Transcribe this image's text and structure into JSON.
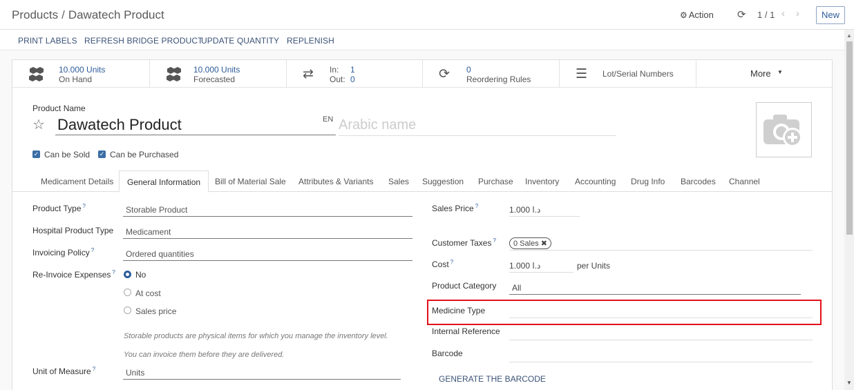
{
  "breadcrumb": {
    "parent": "Products",
    "separator": "/",
    "current": "Dawatech Product"
  },
  "topbar": {
    "action_label": "Action",
    "pager": "1 / 1",
    "new_label": "New"
  },
  "buttons": [
    "PRINT LABELS",
    "REFRESH BRIDGE PRODUCT",
    "UPDATE QUANTITY",
    "REPLENISH"
  ],
  "stats": {
    "on_hand": {
      "value": "10.000 Units",
      "label": "On Hand"
    },
    "forecasted": {
      "value": "10.000 Units",
      "label": "Forecasted"
    },
    "moves": {
      "in_label": "In:",
      "in_value": "1",
      "out_label": "Out:",
      "out_value": "0"
    },
    "reordering": {
      "value": "0",
      "label": "Reordering Rules"
    },
    "lots": {
      "label": "Lot/Serial Numbers"
    },
    "more": {
      "label": "More"
    }
  },
  "product": {
    "name_label": "Product Name",
    "name": "Dawatech Product",
    "lang": "EN",
    "arabic_placeholder": "Arabic name",
    "can_be_sold": "Can be Sold",
    "can_be_purchased": "Can be Purchased"
  },
  "tabs": [
    "Medicament Details",
    "General Information",
    "Bill of Material Sale",
    "Attributes & Variants",
    "Sales",
    "Suggestion",
    "Purchase",
    "Inventory",
    "Accounting",
    "Drug Info",
    "Barcodes",
    "Channel"
  ],
  "left": {
    "product_type_label": "Product Type",
    "product_type_value": "Storable Product",
    "hospital_type_label": "Hospital Product Type",
    "hospital_type_value": "Medicament",
    "invoicing_label": "Invoicing Policy",
    "invoicing_value": "Ordered quantities",
    "reinvoice_label": "Re-Invoice Expenses",
    "reinvoice_options": [
      "No",
      "At cost",
      "Sales price"
    ],
    "help_1": "Storable products are physical items for which you manage the inventory level.",
    "help_2": "You can invoice them before they are delivered.",
    "uom_label": "Unit of Measure",
    "uom_value": "Units"
  },
  "right": {
    "sales_price_label": "Sales Price",
    "sales_price_value": "د.ا 1.000",
    "customer_taxes_label": "Customer Taxes",
    "customer_taxes_tag": "0 Sales",
    "cost_label": "Cost",
    "cost_value": "د.ا 1.000",
    "cost_unit": "per Units",
    "category_label": "Product Category",
    "category_value": "All",
    "medicine_type_label": "Medicine Type",
    "internal_ref_label": "Internal Reference",
    "barcode_label": "Barcode",
    "generate_barcode": "GENERATE THE BARCODE"
  },
  "colors": {
    "accent": "#2d5c9a",
    "highlight": "#e1101a"
  }
}
